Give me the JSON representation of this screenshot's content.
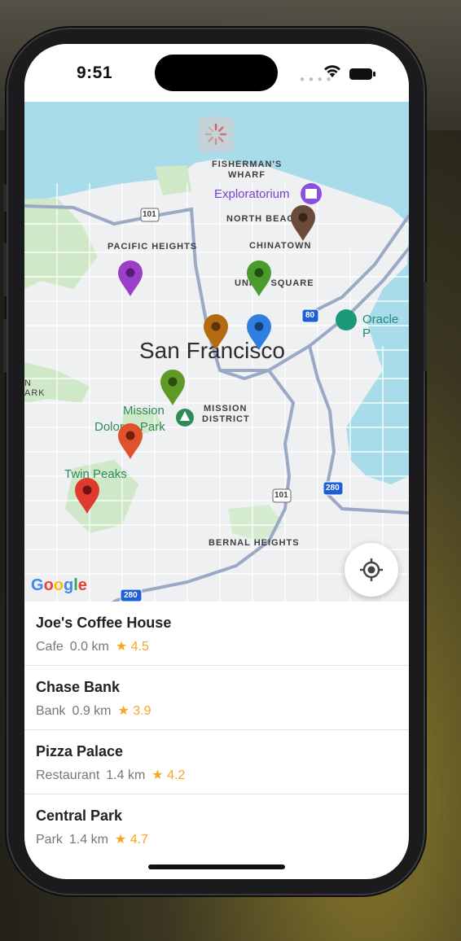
{
  "status": {
    "time": "9:51"
  },
  "map": {
    "labels": {
      "fishermans_wharf_1": "FISHERMAN'S",
      "fishermans_wharf_2": "WHARF",
      "exploratorium": "Exploratorium",
      "north_beach": "NORTH BEAC",
      "pacific_heights": "PACIFIC HEIGHTS",
      "chinatown": "CHINATOWN",
      "union_square": "UNION SQUARE",
      "oracle_park": "Oracle P",
      "san_francisco": "San Francisco",
      "mission_district_1": "MISSION",
      "mission_district_2": "DISTRICT",
      "mission_dolores_1": "Mission",
      "mission_dolores_2": "Dolores Park",
      "twin_peaks": "Twin Peaks",
      "bernal_heights": "BERNAL HEIGHTS",
      "park_fragment_1": "N",
      "park_fragment_2": "ARK",
      "hwy_101_a": "101",
      "hwy_101_b": "101",
      "hwy_80": "80",
      "hwy_280_a": "280",
      "hwy_280_b": "280"
    },
    "pins": [
      {
        "name": "purple",
        "color": "#9b3fc9"
      },
      {
        "name": "green-union",
        "color": "#4a9a2e"
      },
      {
        "name": "brown-northbeach",
        "color": "#6b4a3a"
      },
      {
        "name": "orange-brown",
        "color": "#b36b12"
      },
      {
        "name": "blue",
        "color": "#2f7fe0"
      },
      {
        "name": "olive-green",
        "color": "#5e9a25"
      },
      {
        "name": "orange-red",
        "color": "#e2522a"
      },
      {
        "name": "red",
        "color": "#e03a2f"
      }
    ],
    "attribution": "Google"
  },
  "places": [
    {
      "name": "Joe's Coffee House",
      "category": "Cafe",
      "distance": "0.0 km",
      "rating": "★ 4.5"
    },
    {
      "name": "Chase Bank",
      "category": "Bank",
      "distance": "0.9 km",
      "rating": "★ 3.9"
    },
    {
      "name": "Pizza Palace",
      "category": "Restaurant",
      "distance": "1.4 km",
      "rating": "★ 4.2"
    },
    {
      "name": "Central Park",
      "category": "Park",
      "distance": "1.4 km",
      "rating": "★ 4.7"
    }
  ]
}
